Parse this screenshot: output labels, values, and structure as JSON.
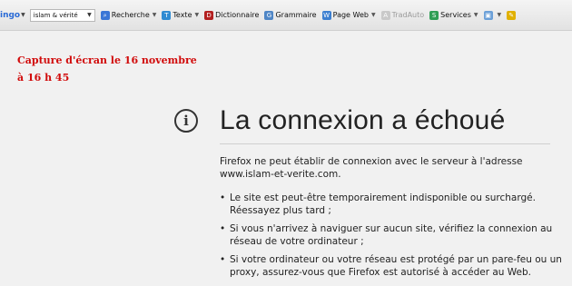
{
  "toolbar": {
    "brand": "ingo",
    "search_value": "islam & vérité",
    "items": [
      {
        "label": "Recherche"
      },
      {
        "label": "Texte"
      },
      {
        "label": "Dictionnaire"
      },
      {
        "label": "Grammaire"
      },
      {
        "label": "Page Web"
      },
      {
        "label": "TradAuto"
      },
      {
        "label": "Services"
      }
    ]
  },
  "annotation": {
    "line1": "Capture d'écran le 16 novembre",
    "line2": "à 16 h 45"
  },
  "error": {
    "title": "La connexion a échoué",
    "message": "Firefox ne peut établir de connexion avec le serveur à l'adresse www.islam-et-verite.com.",
    "bullets": [
      "Le site est peut-être temporairement indisponible ou surchargé. Réessayez plus tard ;",
      "Si vous n'arrivez à naviguer sur aucun site, vérifiez la connexion au réseau de votre ordinateur ;",
      "Si votre ordinateur ou votre réseau est protégé par un pare-feu ou un proxy, assurez-vous que Firefox est autorisé à accéder au Web."
    ]
  }
}
